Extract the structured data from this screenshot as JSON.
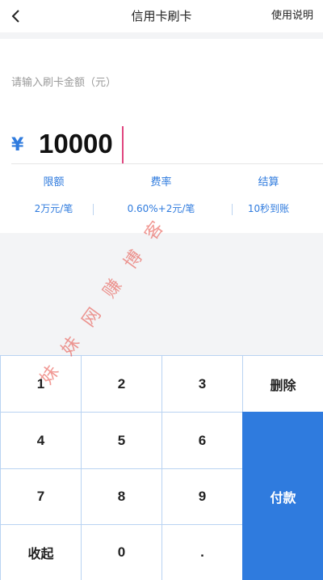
{
  "header": {
    "title": "信用卡刷卡",
    "help_label": "使用说明"
  },
  "amount": {
    "label": "请输入刷卡金额（元）",
    "currency_symbol": "¥",
    "value": "10000"
  },
  "info": [
    {
      "label": "限额",
      "value": "2万元/笔"
    },
    {
      "label": "费率",
      "value": "0.60%+2元/笔"
    },
    {
      "label": "结算",
      "value": "10秒到账"
    }
  ],
  "keypad": {
    "digits": [
      "1",
      "2",
      "3",
      "4",
      "5",
      "6",
      "7",
      "8",
      "9",
      "0",
      "."
    ],
    "delete_label": "删除",
    "collapse_label": "收起",
    "pay_label": "付款"
  },
  "watermark": {
    "text": "妹妹网赚博客"
  },
  "colors": {
    "accent": "#2f7bde",
    "caret": "#e0467f",
    "watermark": "#e6463c"
  }
}
